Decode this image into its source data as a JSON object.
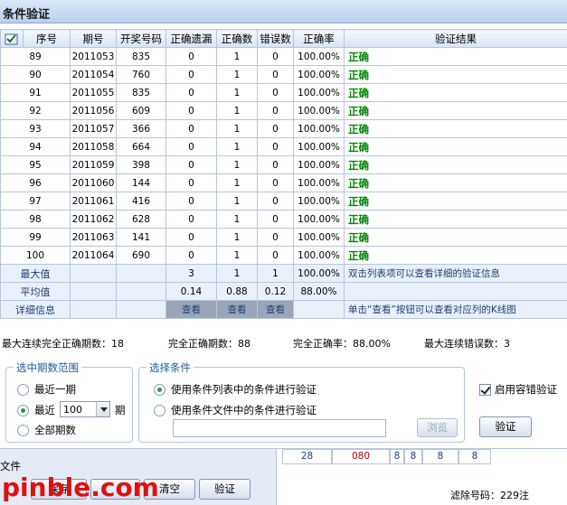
{
  "window": {
    "title": "条件验证"
  },
  "table": {
    "headers": [
      "序号",
      "期号",
      "开奖号码",
      "正确遗漏",
      "正确数",
      "错误数",
      "正确率",
      "验证结果"
    ],
    "rows": [
      [
        "89",
        "2011053",
        "835",
        "0",
        "1",
        "0",
        "100.00%",
        "正确"
      ],
      [
        "90",
        "2011054",
        "760",
        "0",
        "1",
        "0",
        "100.00%",
        "正确"
      ],
      [
        "91",
        "2011055",
        "835",
        "0",
        "1",
        "0",
        "100.00%",
        "正确"
      ],
      [
        "92",
        "2011056",
        "609",
        "0",
        "1",
        "0",
        "100.00%",
        "正确"
      ],
      [
        "93",
        "2011057",
        "366",
        "0",
        "1",
        "0",
        "100.00%",
        "正确"
      ],
      [
        "94",
        "2011058",
        "664",
        "0",
        "1",
        "0",
        "100.00%",
        "正确"
      ],
      [
        "95",
        "2011059",
        "398",
        "0",
        "1",
        "0",
        "100.00%",
        "正确"
      ],
      [
        "96",
        "2011060",
        "144",
        "0",
        "1",
        "0",
        "100.00%",
        "正确"
      ],
      [
        "97",
        "2011061",
        "416",
        "0",
        "1",
        "0",
        "100.00%",
        "正确"
      ],
      [
        "98",
        "2011062",
        "628",
        "0",
        "1",
        "0",
        "100.00%",
        "正确"
      ],
      [
        "99",
        "2011063",
        "141",
        "0",
        "1",
        "0",
        "100.00%",
        "正确"
      ],
      [
        "100",
        "2011064",
        "690",
        "0",
        "1",
        "0",
        "100.00%",
        "正确"
      ]
    ],
    "max_row": {
      "label": "最大值",
      "c3": "3",
      "c4": "1",
      "c5": "1",
      "c6": "100.00%",
      "note": "双击列表项可以查看详细的验证信息"
    },
    "avg_row": {
      "label": "平均值",
      "c3": "0.14",
      "c4": "0.88",
      "c5": "0.12",
      "c6": "88.00%"
    },
    "detail_row": {
      "label": "详细信息",
      "btn": "查看",
      "note": "单击“查看”按钮可以查看对应列的K线图"
    }
  },
  "stats": {
    "max_consecutive_correct": "最大连续完全正确期数：18",
    "total_correct": "完全正确期数：88",
    "correct_rate": "完全正确率：88.00%",
    "max_consecutive_errors": "最大连续错误数：3"
  },
  "period_range": {
    "legend": "选中期数范围",
    "options": [
      "最近一期",
      "最近",
      "全部期数"
    ],
    "selected_index": 1,
    "count_value": "100",
    "suffix": "期"
  },
  "conditions": {
    "legend": "选择条件",
    "options": [
      "使用条件列表中的条件进行验证",
      "使用条件文件中的条件进行验证"
    ],
    "selected_index": 0,
    "file_path": "",
    "browse_label": "浏览"
  },
  "fault_tolerance": {
    "label": "启用容错验证",
    "checked": true
  },
  "verify_label": "验证",
  "bottom": {
    "file_label": "文件",
    "buttons": [
      "保存",
      "清空",
      "验证"
    ],
    "numbers": [
      "28",
      "080",
      "8",
      "8",
      "8",
      "8"
    ],
    "filter_text": "滤除号码：229注"
  },
  "watermark": "pinble.com",
  "colors": {
    "ok": "#008a00",
    "watermark": "#e01010",
    "link": "#1f3f75"
  }
}
